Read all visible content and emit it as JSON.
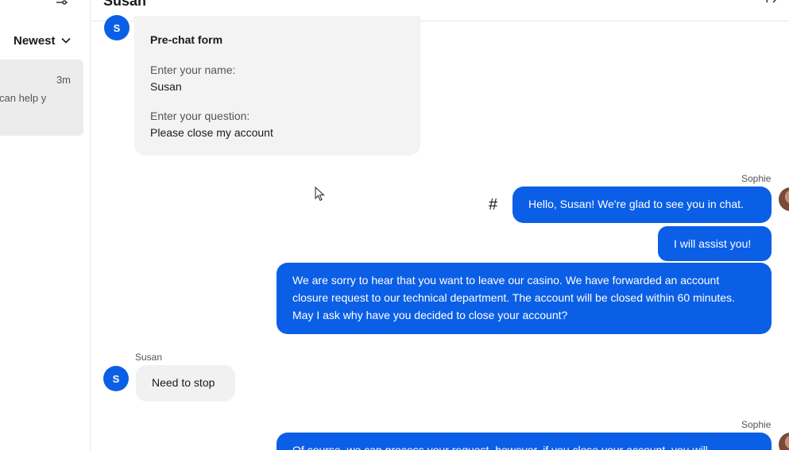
{
  "sidebar": {
    "sort_label": "Newest",
    "conversation": {
      "time": "3m",
      "preview": "can help y"
    }
  },
  "header": {
    "title": "Susan"
  },
  "messages": {
    "prechat": {
      "avatar_initial": "S",
      "title": "Pre-chat form",
      "name_label": "Enter your name:",
      "name_value": "Susan",
      "question_label": "Enter your question:",
      "question_value": "Please close my account"
    },
    "agent_block_1": {
      "sender": "Sophie",
      "hash": "#",
      "m1": "Hello, Susan! We're glad to see you in chat.",
      "m2": "I will assist you!",
      "m3": "We are sorry to hear that you want to leave our casino. We have forwarded an account closure request to our technical department. The account will be closed within 60 minutes. May I ask why have you decided to close your account?"
    },
    "customer_block": {
      "sender": "Susan",
      "avatar_initial": "S",
      "m1": "Need to stop"
    },
    "agent_block_2": {
      "sender": "Sophie",
      "m1": "Of course, we can process your request, however, if you close your account, you will"
    }
  }
}
